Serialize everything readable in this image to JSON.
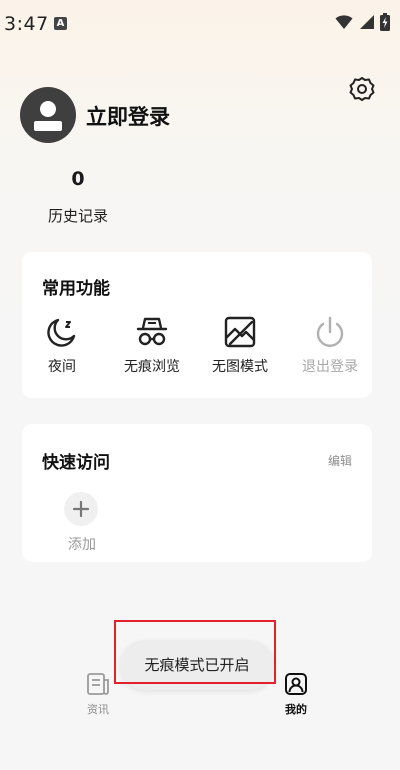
{
  "status_bar": {
    "time": "3:47",
    "notification_letter": "A"
  },
  "profile": {
    "login_label": "立即登录",
    "history_count": "0",
    "history_label": "历史记录"
  },
  "functions": {
    "title": "常用功能",
    "items": [
      {
        "label": "夜间",
        "icon": "moon-icon"
      },
      {
        "label": "无痕浏览",
        "icon": "incognito-icon"
      },
      {
        "label": "无图模式",
        "icon": "no-image-icon"
      },
      {
        "label": "退出登录",
        "icon": "power-icon"
      }
    ]
  },
  "quick_access": {
    "title": "快速访问",
    "edit_label": "编辑",
    "add_label": "添加"
  },
  "tabs": [
    {
      "label": "资讯",
      "icon": "news-icon"
    },
    {
      "label": "我的",
      "icon": "profile-icon"
    }
  ],
  "toast": {
    "message": "无痕模式已开启"
  },
  "colors": {
    "highlight": "#e0232b",
    "disabled_text": "#a8a8a8",
    "avatar": "#3f3f3f"
  }
}
